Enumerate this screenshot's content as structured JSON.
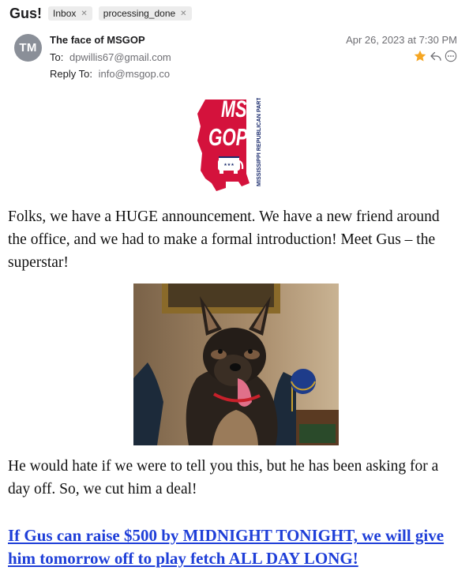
{
  "email": {
    "subject": "Gus!",
    "tags": [
      {
        "label": "Inbox"
      },
      {
        "label": "processing_done"
      }
    ],
    "avatar_initials": "TM",
    "sender_name": "The face of MSGOP",
    "to_label": "To:",
    "to_value": "dpwillis67@gmail.com",
    "reply_to_label": "Reply To:",
    "reply_to_value": "info@msgop.co",
    "date": "Apr 26, 2023 at 7:30 PM",
    "action_icons": [
      "star-icon",
      "reply-icon",
      "more-options-icon"
    ]
  },
  "logo": {
    "main_text_1": "MS",
    "main_text_2": "GOP",
    "side_text": "MISSISSIPPI REPUBLICAN PARTY",
    "brand_color": "#d4123c"
  },
  "body": {
    "paragraph1": "Folks, we have a HUGE announcement. We have a new friend around the office, and we had to make a formal introduction! Meet Gus – the superstar!",
    "paragraph2": "He would hate if we were to tell you this, but he has been asking for a day off. So, we cut him a deal!",
    "cta_link": "If Gus can raise $500 by MIDNIGHT TONIGHT, we will give him tomorrow off to play fetch ALL DAY LONG!"
  },
  "colors": {
    "link": "#1f3fd8",
    "star": "#f5a623",
    "avatar_bg": "#8a8f98"
  }
}
